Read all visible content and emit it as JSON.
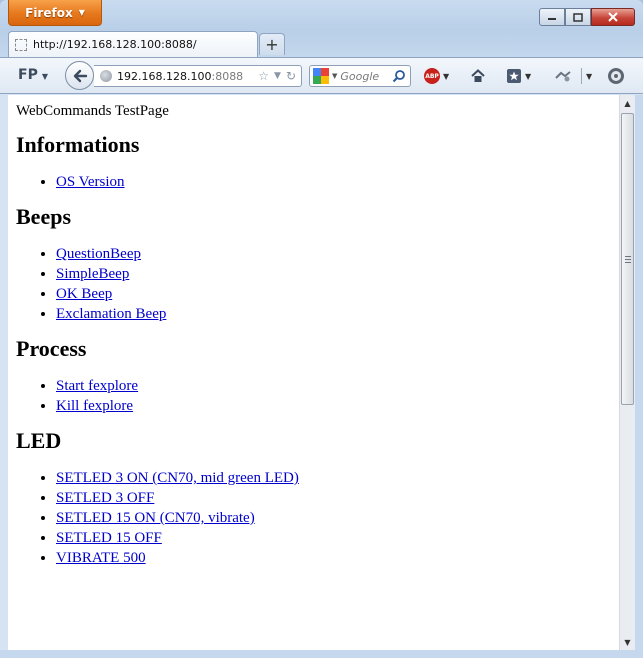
{
  "browser": {
    "menu_button": "Firefox",
    "tab_title": "http://192.168.128.100:8088/",
    "new_tab_label": "+",
    "address_host": "192.168.128.100",
    "address_port": ":8088",
    "search_placeholder": "Google",
    "toolbar_fp": "FP",
    "abp_label": "ABP"
  },
  "page": {
    "intro": "WebCommands TestPage",
    "sections": [
      {
        "heading": "Informations",
        "links": [
          "OS Version"
        ]
      },
      {
        "heading": "Beeps",
        "links": [
          "QuestionBeep",
          "SimpleBeep",
          "OK Beep",
          "Exclamation Beep"
        ]
      },
      {
        "heading": "Process",
        "links": [
          "Start fexplore",
          "Kill fexplore"
        ]
      },
      {
        "heading": "LED",
        "links": [
          "SETLED 3 ON (CN70, mid green LED)",
          "SETLED 3 OFF",
          "SETLED 15 ON (CN70, vibrate)",
          "SETLED 15 OFF",
          "VIBRATE 500"
        ]
      }
    ]
  },
  "colors": {
    "link": "#0000cc",
    "firefox_button": "#e6781d",
    "close_button": "#c8463a"
  }
}
